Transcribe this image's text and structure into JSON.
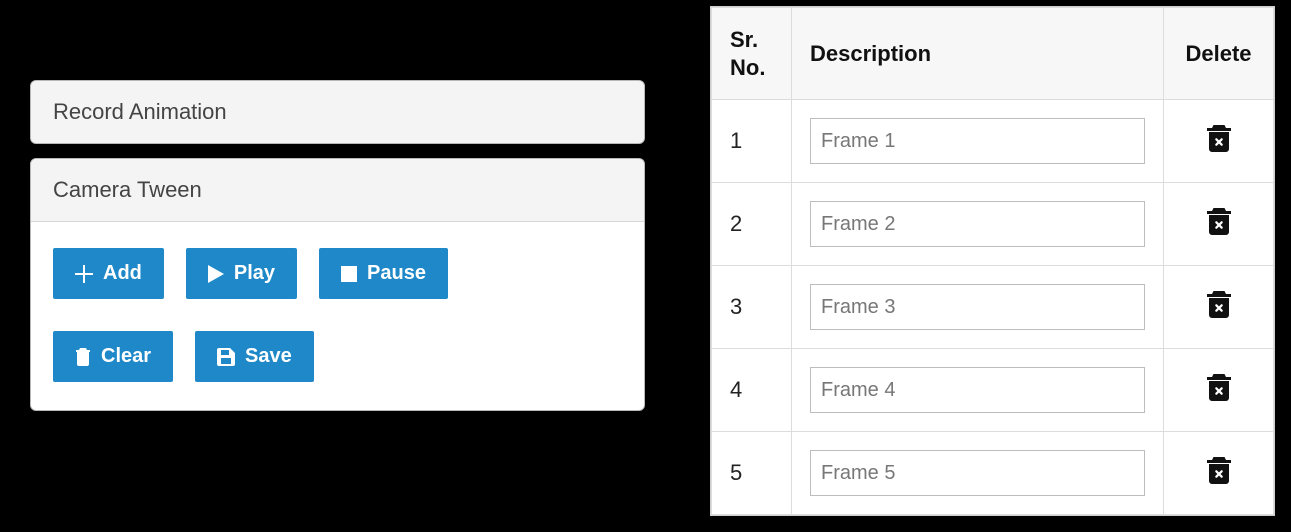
{
  "colors": {
    "primary": "#1e88c8"
  },
  "panels": {
    "record": {
      "title": "Record Animation"
    },
    "tween": {
      "title": "Camera Tween",
      "buttons": {
        "add": "Add",
        "play": "Play",
        "pause": "Pause",
        "clear": "Clear",
        "save": "Save"
      }
    }
  },
  "table": {
    "headers": {
      "sr": "Sr. No.",
      "description": "Description",
      "delete": "Delete"
    },
    "rows": [
      {
        "sr": "1",
        "desc": "Frame 1"
      },
      {
        "sr": "2",
        "desc": "Frame 2"
      },
      {
        "sr": "3",
        "desc": "Frame 3"
      },
      {
        "sr": "4",
        "desc": "Frame 4"
      },
      {
        "sr": "5",
        "desc": "Frame 5"
      }
    ]
  },
  "icons": {
    "plus": "plus-icon",
    "play": "play-icon",
    "pause": "stop-icon",
    "clear": "trash-icon",
    "save": "save-icon",
    "delete": "trash-x-icon"
  }
}
